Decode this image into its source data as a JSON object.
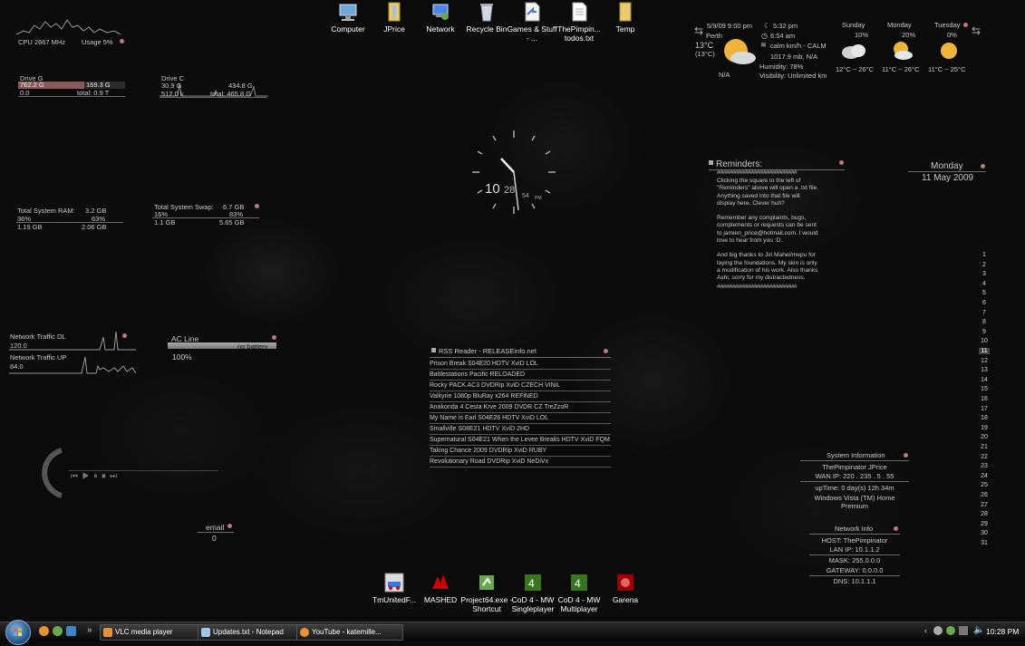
{
  "desktop_icons_top": [
    {
      "label": "Computer",
      "icon": "computer-icon"
    },
    {
      "label": "JPrice",
      "icon": "folder-icon"
    },
    {
      "label": "Network",
      "icon": "network-icon"
    },
    {
      "label": "Recycle Bin",
      "icon": "recycle-bin-icon"
    },
    {
      "label": "Games & Stuff - ...",
      "icon": "shortcut-icon"
    },
    {
      "label": "ThePimpin... todos.txt",
      "icon": "text-file-icon"
    },
    {
      "label": "Temp",
      "icon": "folder-icon"
    }
  ],
  "desktop_icons_bottom": [
    {
      "label": "TmUnitedF...",
      "icon": "game-icon"
    },
    {
      "label": "MASHED",
      "icon": "game-icon"
    },
    {
      "label": "Project64.exe - Shortcut",
      "icon": "emulator-icon"
    },
    {
      "label": "CoD 4 - MW Singleplayer",
      "icon": "game-icon"
    },
    {
      "label": "CoD 4 - MW Multiplayer",
      "icon": "game-icon"
    },
    {
      "label": "Garena",
      "icon": "garena-icon"
    }
  ],
  "cpu": {
    "freq": "CPU 2667 MHz",
    "usage": "Usage 5%"
  },
  "drive_g": {
    "label": "Drive G",
    "used": "762.2 G",
    "free": "169.3 G",
    "io": "0.0",
    "total": "total: 0.9 T"
  },
  "drive_c": {
    "label": "Drive C",
    "used": "30.9 G",
    "free": "434.8 G",
    "io": "512.0 k",
    "total": "total: 465.8 G"
  },
  "ram": {
    "label": "Total System RAM:",
    "value": "3.2 GB",
    "pct_left": "36%",
    "pct_right": "63%",
    "used": "1.19 GB",
    "free": "2.06 GB"
  },
  "swap": {
    "label": "Total System Swap:",
    "value": "6.7 GB",
    "pct_left": "16%",
    "pct_right": "83%",
    "used": "1.1 GB",
    "free": "5.65 GB"
  },
  "network": {
    "dl_label": "Network Traffic DL",
    "dl_value": "120.0",
    "up_label": "Network Traffic UP",
    "up_value": "84.0"
  },
  "power": {
    "label": "AC Line",
    "status": "no battery",
    "percent": "100%"
  },
  "media_controls": "⏮ ▶ ⏸ ⏹ ⏭",
  "email": {
    "label": "email",
    "count": "0"
  },
  "clock": {
    "hour": "10",
    "minute": "28",
    "seconds": "54",
    "ampm": "PM"
  },
  "weather": {
    "datetime": "5/9/09 9:00 pm",
    "sunset": "5:32 pm",
    "sunrise": "6:54 am",
    "location": "Perth",
    "temp": "13°C",
    "feels": "(13°C)",
    "wind": "calm km/h - CALM",
    "pressure": "1017.9 mb, N/A",
    "humidity": "Humidity: 78%",
    "visibility": "Visibility: Unlimited km",
    "condition": "N/A",
    "forecast": [
      {
        "day": "Sunday",
        "precip": "10%",
        "range": "12°C ~ 26°C"
      },
      {
        "day": "Monday",
        "precip": "20%",
        "range": "11°C ~ 26°C"
      },
      {
        "day": "Tuesday",
        "precip": "0%",
        "range": "11°C ~ 25°C"
      }
    ]
  },
  "reminders": {
    "title": "Reminders:",
    "divider": "###############################",
    "lines": [
      "Clicking the square to the left of",
      "\"Reminders\" above will open a .txt file.",
      "Anything saved into that file will",
      "display here. Clever huh?",
      "",
      "Remember any complaints, bugs,",
      "complements or requests can be sent",
      "to jamien_price@hotmail.com. I would",
      "love to hear from you :D.",
      "",
      "And big thanks to Jiri Mahel/mepu for",
      "laying the foundations. My skin is only",
      "a modification of his work. Also thanks",
      "Ashi, sorry for my distractedness."
    ]
  },
  "date": {
    "weekday": "Monday",
    "full": "11 May 2009"
  },
  "calendar_days": [
    "1",
    "2",
    "3",
    "4",
    "5",
    "6",
    "7",
    "8",
    "9",
    "10",
    "11",
    "12",
    "13",
    "14",
    "15",
    "16",
    "17",
    "18",
    "19",
    "20",
    "21",
    "22",
    "23",
    "24",
    "25",
    "26",
    "27",
    "28",
    "29",
    "30",
    "31"
  ],
  "calendar_today_index": 10,
  "rss": {
    "title": "RSS Reader - RELEASEinfo.net",
    "items": [
      "Prison Break S04E20 HDTV XviD LOL",
      "Battlestations Pacific RELOADED",
      "Rocky PACK AC3 DVDRip XviD CZECH VINiL",
      "Valkyrie 1080p BluRay x264 REFiNED",
      "Anakonda 4 Cesta Krve 2009 DVDR CZ TreZzoR",
      "My Name is Earl S04E26 HDTV XviD LOL",
      "Smallville S08E21 HDTV XviD 2HD",
      "Supernatural S04E21 When the Levee Breaks HDTV XviD FQM",
      "Taking Chance 2009 DVDRip XviD RUBY",
      "Revolutionary Road DVDRip XviD NeDiVx"
    ]
  },
  "sysinfo": {
    "title": "System Information",
    "user": "ThePimpinator  JPrice",
    "wan": "WAN IP: 220 . 235 . 5 . 55",
    "uptime": "upTime: 0 day(s) 12h 34m",
    "os": "Windows Vista (TM) Home Premium"
  },
  "netinfo": {
    "title": "Network Info",
    "host": "HOST: ThePimpinator",
    "lan": "LAN IP: 10.1.1.2",
    "mask": "MASK: 255.0.0.0",
    "gateway": "GATEWAY: 0.0.0.0",
    "dns": "DNS: 10.1.1.1"
  },
  "taskbar": {
    "windows": [
      {
        "label": "VLC media player",
        "icon": "vlc-icon"
      },
      {
        "label": "Updates.txt - Notepad",
        "icon": "notepad-icon"
      },
      {
        "label": "YouTube - katemille...",
        "icon": "firefox-icon"
      }
    ],
    "time": "10:28 PM",
    "quicklaunch_overflow": "»"
  }
}
